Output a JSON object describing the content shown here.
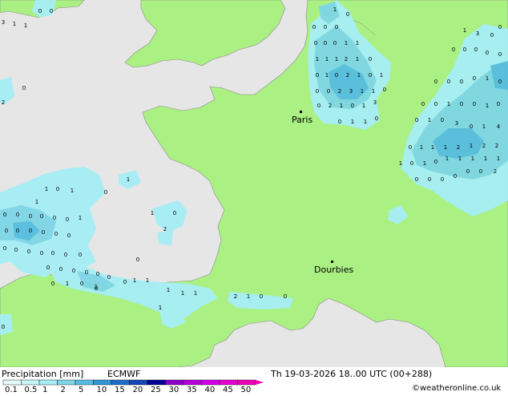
{
  "map": {
    "cities": [
      {
        "name": "Paris"
      },
      {
        "name": "Dourbies"
      }
    ],
    "colors": {
      "land": "#aaf083",
      "sea": "#e6e6e6",
      "precip_light": "#a6eef5",
      "precip_mid": "#7ed6e6",
      "precip_heavy": "#55bde0",
      "cell_digit": "#000000"
    },
    "grid_values": [
      "0",
      "0",
      "0",
      "0",
      "1",
      "0",
      "0",
      "0",
      "1",
      "1",
      "1",
      "1",
      "1",
      "2",
      "1",
      "0",
      "0",
      "1",
      "0",
      "2",
      "1",
      "0",
      "1",
      "0",
      "0",
      "2",
      "3",
      "1",
      "1",
      "0",
      "0",
      "2",
      "1",
      "0",
      "1",
      "3",
      "0",
      "1",
      "1",
      "0",
      "1",
      "3",
      "0",
      "0",
      "0",
      "0",
      "0",
      "0",
      "0",
      "0",
      "0",
      "0",
      "0",
      "1",
      "0",
      "0",
      "0",
      "1",
      "0",
      "0",
      "1",
      "0",
      "0",
      "1",
      "0",
      "3",
      "0",
      "1",
      "4",
      "0",
      "1",
      "1",
      "1",
      "2",
      "1",
      "2",
      "2",
      "1",
      "0",
      "1",
      "0",
      "1",
      "1",
      "1",
      "1",
      "1",
      "0",
      "0",
      "0",
      "0",
      "0",
      "0",
      "2",
      "1",
      "1",
      "0",
      "1",
      "0",
      "1",
      "0",
      "0",
      "0",
      "0",
      "0",
      "0",
      "1",
      "0",
      "0",
      "0",
      "0",
      "0",
      "0",
      "0",
      "0",
      "0",
      "0",
      "0",
      "0",
      "0",
      "0",
      "0",
      "0"
    ]
  },
  "legend": {
    "title": "Precipitation [mm]",
    "model": "ECMWF",
    "ticks": [
      "0.1",
      "0.5",
      "1",
      "2",
      "5",
      "10",
      "15",
      "20",
      "25",
      "30",
      "35",
      "40",
      "45",
      "50"
    ],
    "colors": [
      "#e6fafa",
      "#c8f5f5",
      "#a6eef5",
      "#7ed6e6",
      "#55bde0",
      "#3296d7",
      "#1e6ec8",
      "#1446b4",
      "#000096",
      "#8c00c8",
      "#b400dc",
      "#d200e6",
      "#e600d2",
      "#f000b4"
    ]
  },
  "footer": {
    "datetime": "Th 19-03-2026 18..00 UTC (00+288)",
    "credit": "©weatheronline.co.uk"
  }
}
